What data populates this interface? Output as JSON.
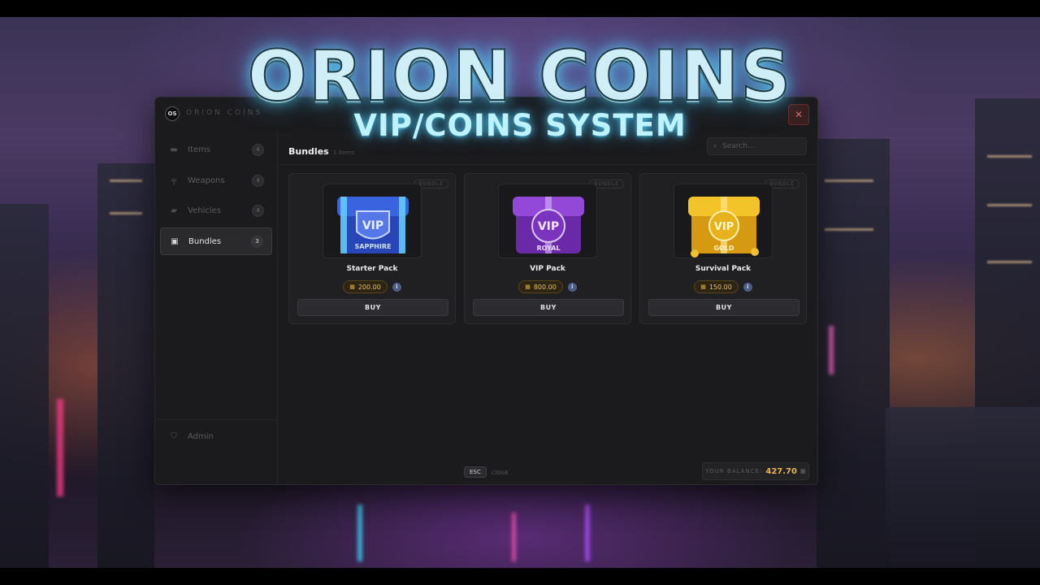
{
  "banner": {
    "title": "ORION COINS",
    "subtitle": "VIP/COINS SYSTEM"
  },
  "window": {
    "logo_text": "OS",
    "app_title": "ORION COINS",
    "close_glyph": "✕"
  },
  "sidebar": {
    "items": [
      {
        "label": "Items",
        "count": "4",
        "icon": "box-icon",
        "active": false
      },
      {
        "label": "Weapons",
        "count": "4",
        "icon": "gun-icon",
        "active": false
      },
      {
        "label": "Vehicles",
        "count": "4",
        "icon": "car-icon",
        "active": false
      },
      {
        "label": "Bundles",
        "count": "3",
        "icon": "gift-icon",
        "active": true
      }
    ],
    "admin_label": "Admin",
    "admin_icon": "shield-icon"
  },
  "main": {
    "section_title": "Bundles",
    "section_count": "3 items",
    "search_placeholder": "Search...",
    "products": [
      {
        "name": "Starter Pack",
        "price": "200.00",
        "tag": "BUNDLE",
        "buy_label": "BUY",
        "chest_label": "SAPPHIRE",
        "color": "#2f5bd6"
      },
      {
        "name": "VIP Pack",
        "price": "800.00",
        "tag": "BUNDLE",
        "buy_label": "BUY",
        "chest_label": "ROYAL",
        "color": "#8a3fd0"
      },
      {
        "name": "Survival Pack",
        "price": "150.00",
        "tag": "BUNDLE",
        "buy_label": "BUY",
        "chest_label": "GOLD",
        "color": "#e7b520"
      }
    ]
  },
  "footer": {
    "esc_key": "ESC",
    "esc_label": "close",
    "balance_label": "YOUR BALANCE:",
    "balance_value": "427.70"
  }
}
